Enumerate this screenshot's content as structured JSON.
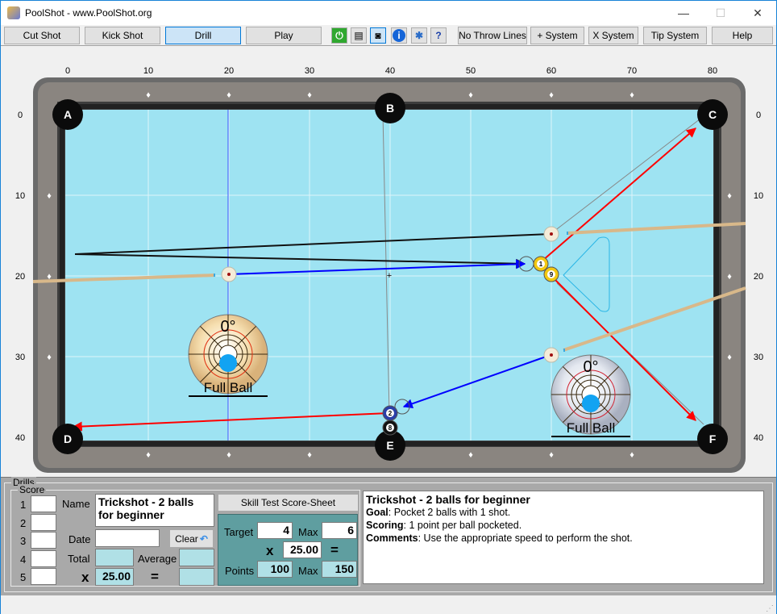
{
  "window": {
    "title": "PoolShot - www.PoolShot.org",
    "minimize": "—",
    "maximize": "☐",
    "close": "✕"
  },
  "toolbar": {
    "buttons": [
      {
        "label": "Cut Shot"
      },
      {
        "label": "Kick Shot"
      },
      {
        "label": "Drill",
        "active": true
      },
      {
        "label": "Play"
      }
    ],
    "icons": [
      "power-icon",
      "print-icon",
      "camera-icon",
      "info-icon",
      "settings-icon",
      "help-document-icon"
    ],
    "buttons2": [
      {
        "label": "No Throw Lines"
      },
      {
        "label": "+ System"
      },
      {
        "label": "X System"
      },
      {
        "label": "Tip System"
      },
      {
        "label": "Help"
      }
    ]
  },
  "table": {
    "top_ruler": [
      "0",
      "10",
      "20",
      "30",
      "40",
      "50",
      "60",
      "70",
      "80"
    ],
    "side_ruler": [
      "0",
      "10",
      "20",
      "30",
      "40"
    ],
    "pockets": [
      {
        "label": "A",
        "x": 0,
        "y": 0
      },
      {
        "label": "B",
        "x": 40,
        "y": -0.8
      },
      {
        "label": "C",
        "x": 80,
        "y": 0
      },
      {
        "label": "D",
        "x": 0,
        "y": 40.2
      },
      {
        "label": "E",
        "x": 40,
        "y": 41
      },
      {
        "label": "F",
        "x": 80,
        "y": 40.2
      }
    ],
    "cue_balls": [
      {
        "x": 60,
        "y": 14.8
      },
      {
        "x": 20,
        "y": 19.8
      },
      {
        "x": 60,
        "y": 29.8
      }
    ],
    "object_balls": [
      {
        "num": "1",
        "x": 58.7,
        "y": 18.5,
        "color": "#f2c811"
      },
      {
        "num": "9",
        "x": 60,
        "y": 19.8,
        "color": "#f2c811"
      },
      {
        "num": "2",
        "x": 40,
        "y": 37,
        "color": "#2a3fa8"
      },
      {
        "num": "8",
        "x": 40,
        "y": 38.8,
        "color": "#111111"
      }
    ],
    "colors": {
      "cloth": "#9ee3f2",
      "rail": "#6b6b6b",
      "aim_line": "#0000ff",
      "object_path": "#ff0000"
    },
    "aim_diagrams": [
      {
        "angle": "0°",
        "label": "Full Ball"
      },
      {
        "angle": "0°",
        "label": "Full Ball"
      }
    ]
  },
  "drills": {
    "group_label": "Drills",
    "score_label": "Score",
    "rows": [
      "1",
      "2",
      "3",
      "4",
      "5"
    ],
    "name_label": "Name",
    "name_value": "Trickshot - 2 balls for beginner",
    "date_label": "Date",
    "date_value": "",
    "clear_label": "Clear",
    "total_label": "Total",
    "average_label": "Average",
    "x_label": "x",
    "multiplier": "25.00",
    "equals": "=",
    "score_sheet_button": "Skill Test Score-Sheet",
    "target_label": "Target",
    "target_value": "4",
    "max_label": "Max",
    "max_value": "6",
    "mult_value": "25.00",
    "points_label": "Points",
    "points_value": "100",
    "points_max_value": "150"
  },
  "description": {
    "title": "Trickshot - 2 balls for beginner",
    "goal_label": "Goal",
    "goal": ": Pocket 2 balls with 1 shot.",
    "scoring_label": "Scoring",
    "scoring": ": 1 point per ball pocketed.",
    "comments_label": "Comments",
    "comments": ": Use the appropriate speed to perform the shot."
  }
}
